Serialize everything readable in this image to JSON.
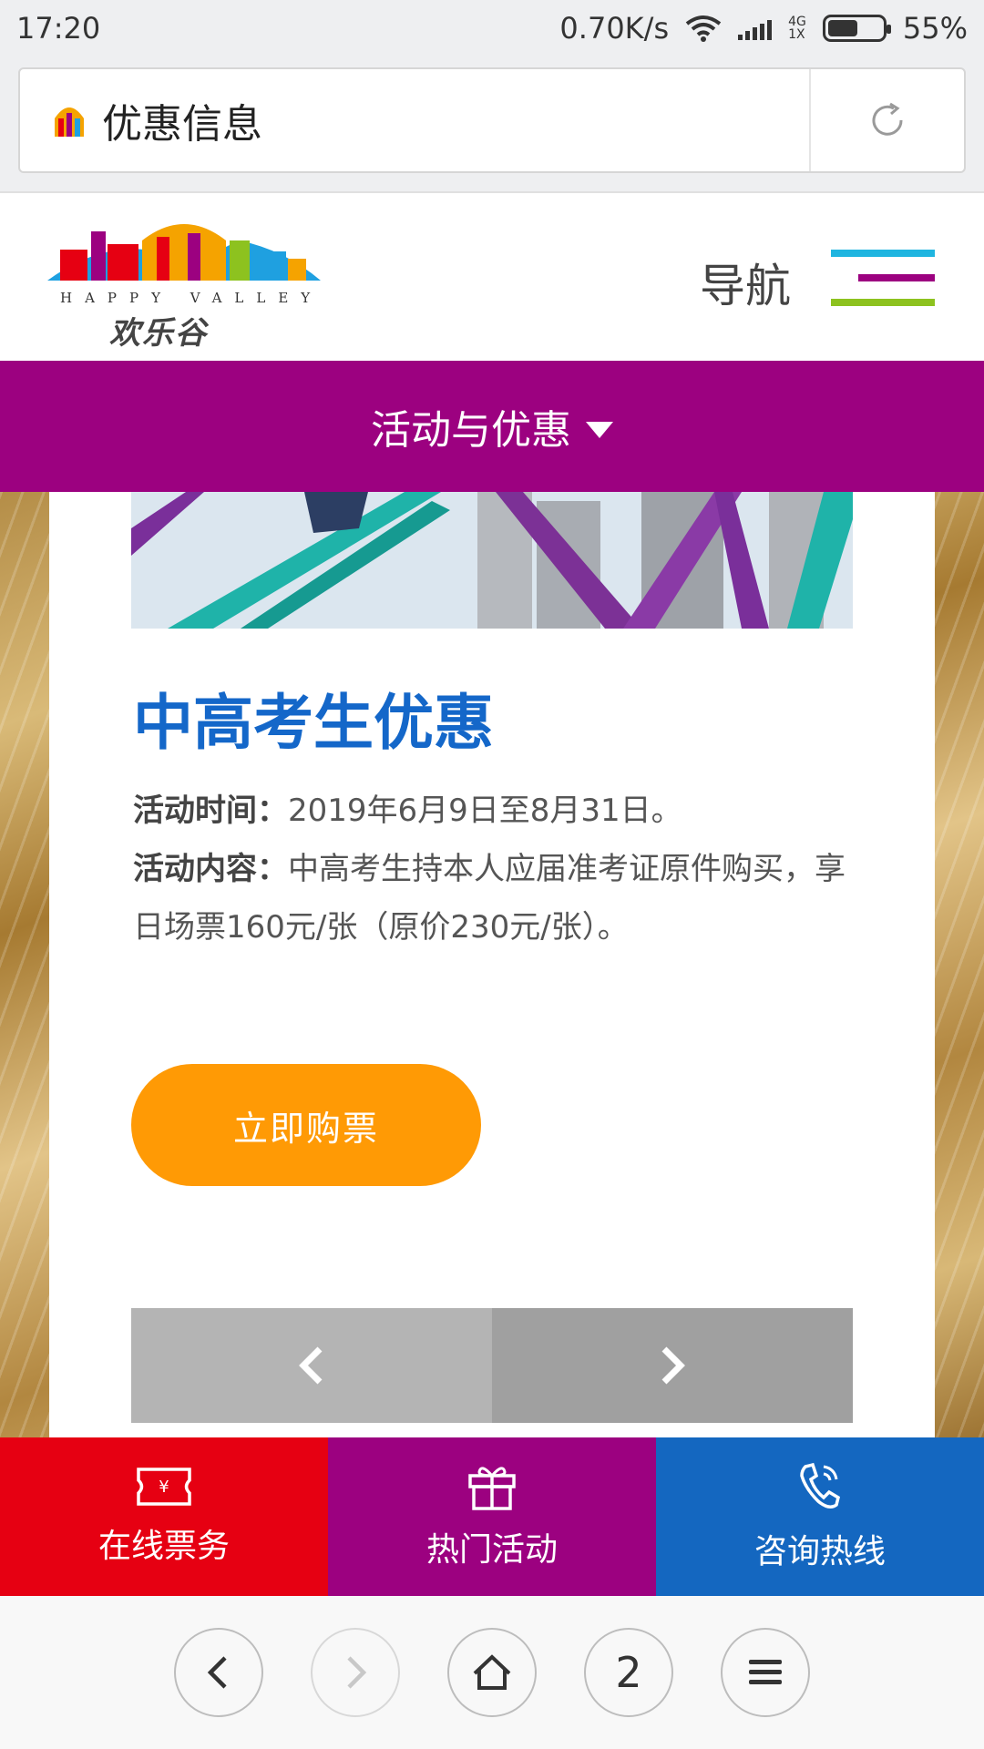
{
  "status_bar": {
    "time": "17:20",
    "speed": "0.70K/s",
    "network_top": "4G",
    "network_bottom": "1X",
    "battery": "55%"
  },
  "browser": {
    "page_title": "优惠信息",
    "tab_count": "2"
  },
  "header": {
    "logo_en": "HAPPY VALLEY",
    "logo_cn": "欢乐谷",
    "nav_label": "导航"
  },
  "category": {
    "label": "活动与优惠"
  },
  "promo": {
    "title": "中高考生优惠",
    "time_label": "活动时间：",
    "time_value": "2019年6月9日至8月31日。",
    "content_label": "活动内容：",
    "content_value": "中高考生持本人应届准考证原件购买，享日场票160元/张（原价230元/张）。",
    "buy_label": "立即购票"
  },
  "bottom_tabs": [
    {
      "label": "在线票务",
      "icon": "ticket-icon"
    },
    {
      "label": "热门活动",
      "icon": "gift-icon"
    },
    {
      "label": "咨询热线",
      "icon": "phone-icon"
    }
  ],
  "colors": {
    "brand_purple": "#9c0180",
    "title_blue": "#1467c9",
    "button_orange": "#ff9a05",
    "tab_red": "#e60012",
    "tab_blue": "#1467c0"
  }
}
